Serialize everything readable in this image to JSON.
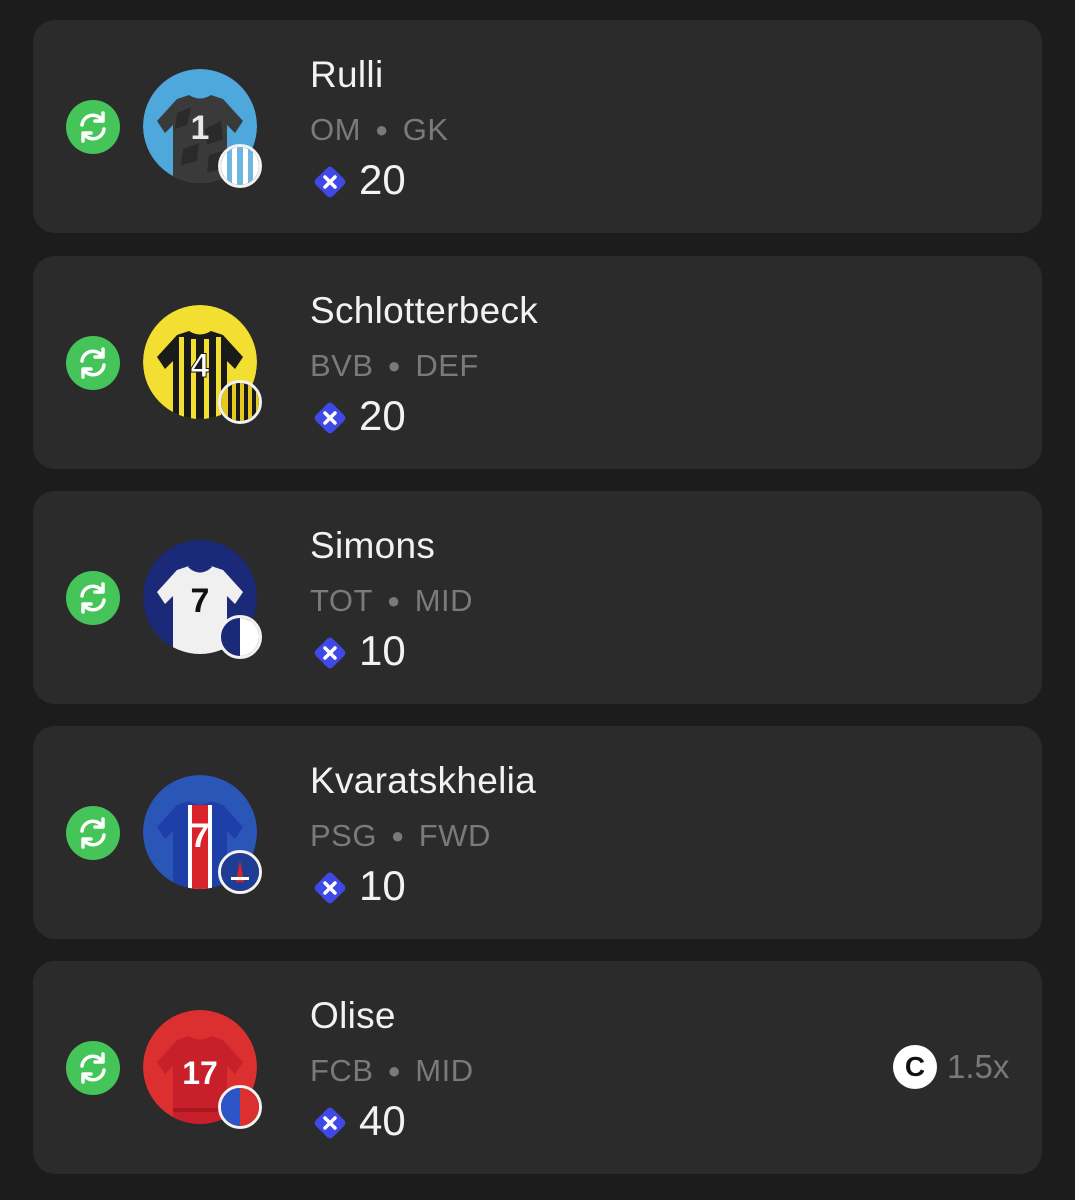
{
  "players": [
    {
      "name": "Rulli",
      "club": "OM",
      "position": "GK",
      "price": "20",
      "kit_colors": {
        "background": "#4fa8dc",
        "shirt": "#3a3a3a",
        "number": "#e8e8e8"
      },
      "kit_number": "1",
      "badge_colors": {
        "primary": "#6fb7e3",
        "secondary": "#ffffff"
      }
    },
    {
      "name": "Schlotterbeck",
      "club": "BVB",
      "position": "DEF",
      "price": "20",
      "kit_colors": {
        "background": "#f3de32",
        "shirt": "#1a1a1a",
        "number": "#f3de32"
      },
      "kit_number": "4",
      "badge_colors": {
        "primary": "#e7c81d",
        "secondary": "#1a1a1a"
      }
    },
    {
      "name": "Simons",
      "club": "TOT",
      "position": "MID",
      "price": "10",
      "kit_colors": {
        "background": "#1b2a78",
        "shirt": "#f0f0f0",
        "number": "#111111"
      },
      "kit_number": "7",
      "badge_colors": {
        "primary": "#1b2a78",
        "secondary": "#ffffff"
      }
    },
    {
      "name": "Kvaratskhelia",
      "club": "PSG",
      "position": "FWD",
      "price": "10",
      "kit_colors": {
        "background": "#2a56b8",
        "shirt": "#1f3fa8",
        "number": "#ffffff"
      },
      "kit_number": "7",
      "badge_colors": {
        "primary": "#1f3d94",
        "secondary": "#d8232a"
      }
    },
    {
      "name": "Olise",
      "club": "FCB",
      "position": "MID",
      "price": "40",
      "kit_colors": {
        "background": "#dc2f2f",
        "shirt": "#c8202b",
        "number": "#ffffff"
      },
      "kit_number": "17",
      "badge_colors": {
        "primary": "#2d55c8",
        "secondary": "#dc2f2f"
      },
      "captain_label": "C",
      "multiplier": "1.5x"
    }
  ],
  "icons": {
    "swap": "swap-arrows-icon",
    "price": "currency-x-icon",
    "captain": "captain-c-icon"
  },
  "colors": {
    "background": "#1c1c1c",
    "card": "#2b2b2b",
    "swap_green": "#45c45a",
    "price_blue": "#3f49e6",
    "muted_text": "#7a7a7a"
  }
}
